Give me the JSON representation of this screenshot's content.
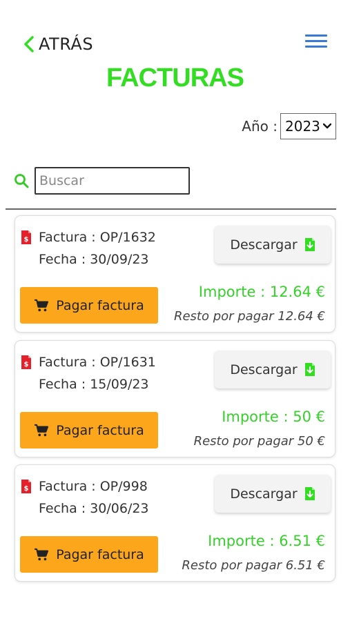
{
  "header": {
    "back_label": "ATRÁS",
    "title": "FACTURAS"
  },
  "filter": {
    "year_label": "Año :",
    "year_value": "2023"
  },
  "search": {
    "placeholder": "Buscar"
  },
  "invoices": [
    {
      "factura": "Factura : OP/1632",
      "fecha": "Fecha : 30/09/23",
      "download_label": "Descargar",
      "pay_label": "Pagar factura",
      "importe": "Importe : 12.64 €",
      "resto": "Resto por pagar 12.64 €"
    },
    {
      "factura": "Factura : OP/1631",
      "fecha": "Fecha : 15/09/23",
      "download_label": "Descargar",
      "pay_label": "Pagar factura",
      "importe": "Importe : 50 €",
      "resto": "Resto por pagar 50 €"
    },
    {
      "factura": "Factura : OP/998",
      "fecha": "Fecha : 30/06/23",
      "download_label": "Descargar",
      "pay_label": "Pagar factura",
      "importe": "Importe : 6.51 €",
      "resto": "Resto por pagar 6.51 €"
    }
  ],
  "colors": {
    "accent_green": "#33dd22",
    "pay_orange": "#fba61b",
    "pdf_red": "#e5202a",
    "menu_blue": "#3a78d6"
  },
  "icons": {
    "back": "chevron-left-icon",
    "menu": "hamburger-menu-icon",
    "search": "search-icon",
    "invoice": "pdf-file-icon",
    "download": "download-file-icon",
    "pay": "shopping-cart-icon",
    "year_select": "chevron-down-icon"
  }
}
